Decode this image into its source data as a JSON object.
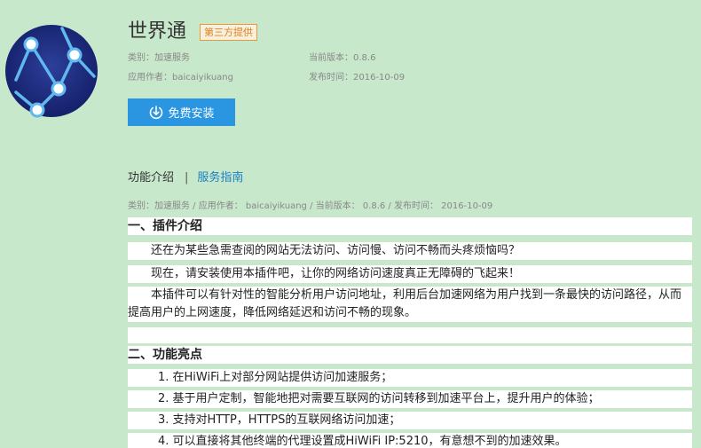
{
  "app": {
    "title": "世界通",
    "badge": "第三方提供",
    "category": "类别：加速服务",
    "author": "应用作者：baicaiyikuang",
    "version": "当前版本：0.8.6",
    "release_date": "发布时间：2016-10-09",
    "install_label": "免费安装",
    "icon": "app-network-logo-icon"
  },
  "tabs": {
    "intro": "功能介绍",
    "separator": "|",
    "guide": "服务指南"
  },
  "sub_meta": "类别：加速服务 / 应用作者： baicaiyikuang / 当前版本： 0.8.6 / 发布时间： 2016-10-09",
  "content": {
    "section1_title": "一、插件介绍",
    "p1": "还在为某些急需查阅的网站无法访问、访问慢、访问不畅而头疼烦恼吗？",
    "p2": "现在，请安装使用本插件吧，让你的网络访问速度真正无障碍的飞起来！",
    "p3_line1": "本插件可以有针对性的智能分析用户访问地址，利用后台加速网络为用户找到一条最快的访问路径，从而",
    "p3_line2": "提高用户的上网速度，降低网络延迟和访问不畅的现象。",
    "section2_title": "二、功能亮点",
    "item1": "1. 在HiWiFi上对部分网站提供访问加速服务；",
    "item2": "2. 基于用户定制，智能地把对需要互联网的访问转移到加速平台上，提升用户的体验；",
    "item3": "3. 支持对HTTP，HTTPS的互联网络访问加速；",
    "item4": "4. 可以直接将其他终端的代理设置成HiWiFi IP:5210，有意想不到的加速效果。"
  },
  "colors": {
    "background": "#c7e8cb",
    "button": "#2a95e0",
    "link": "#1b7fc6",
    "badge": "#e2801f"
  }
}
